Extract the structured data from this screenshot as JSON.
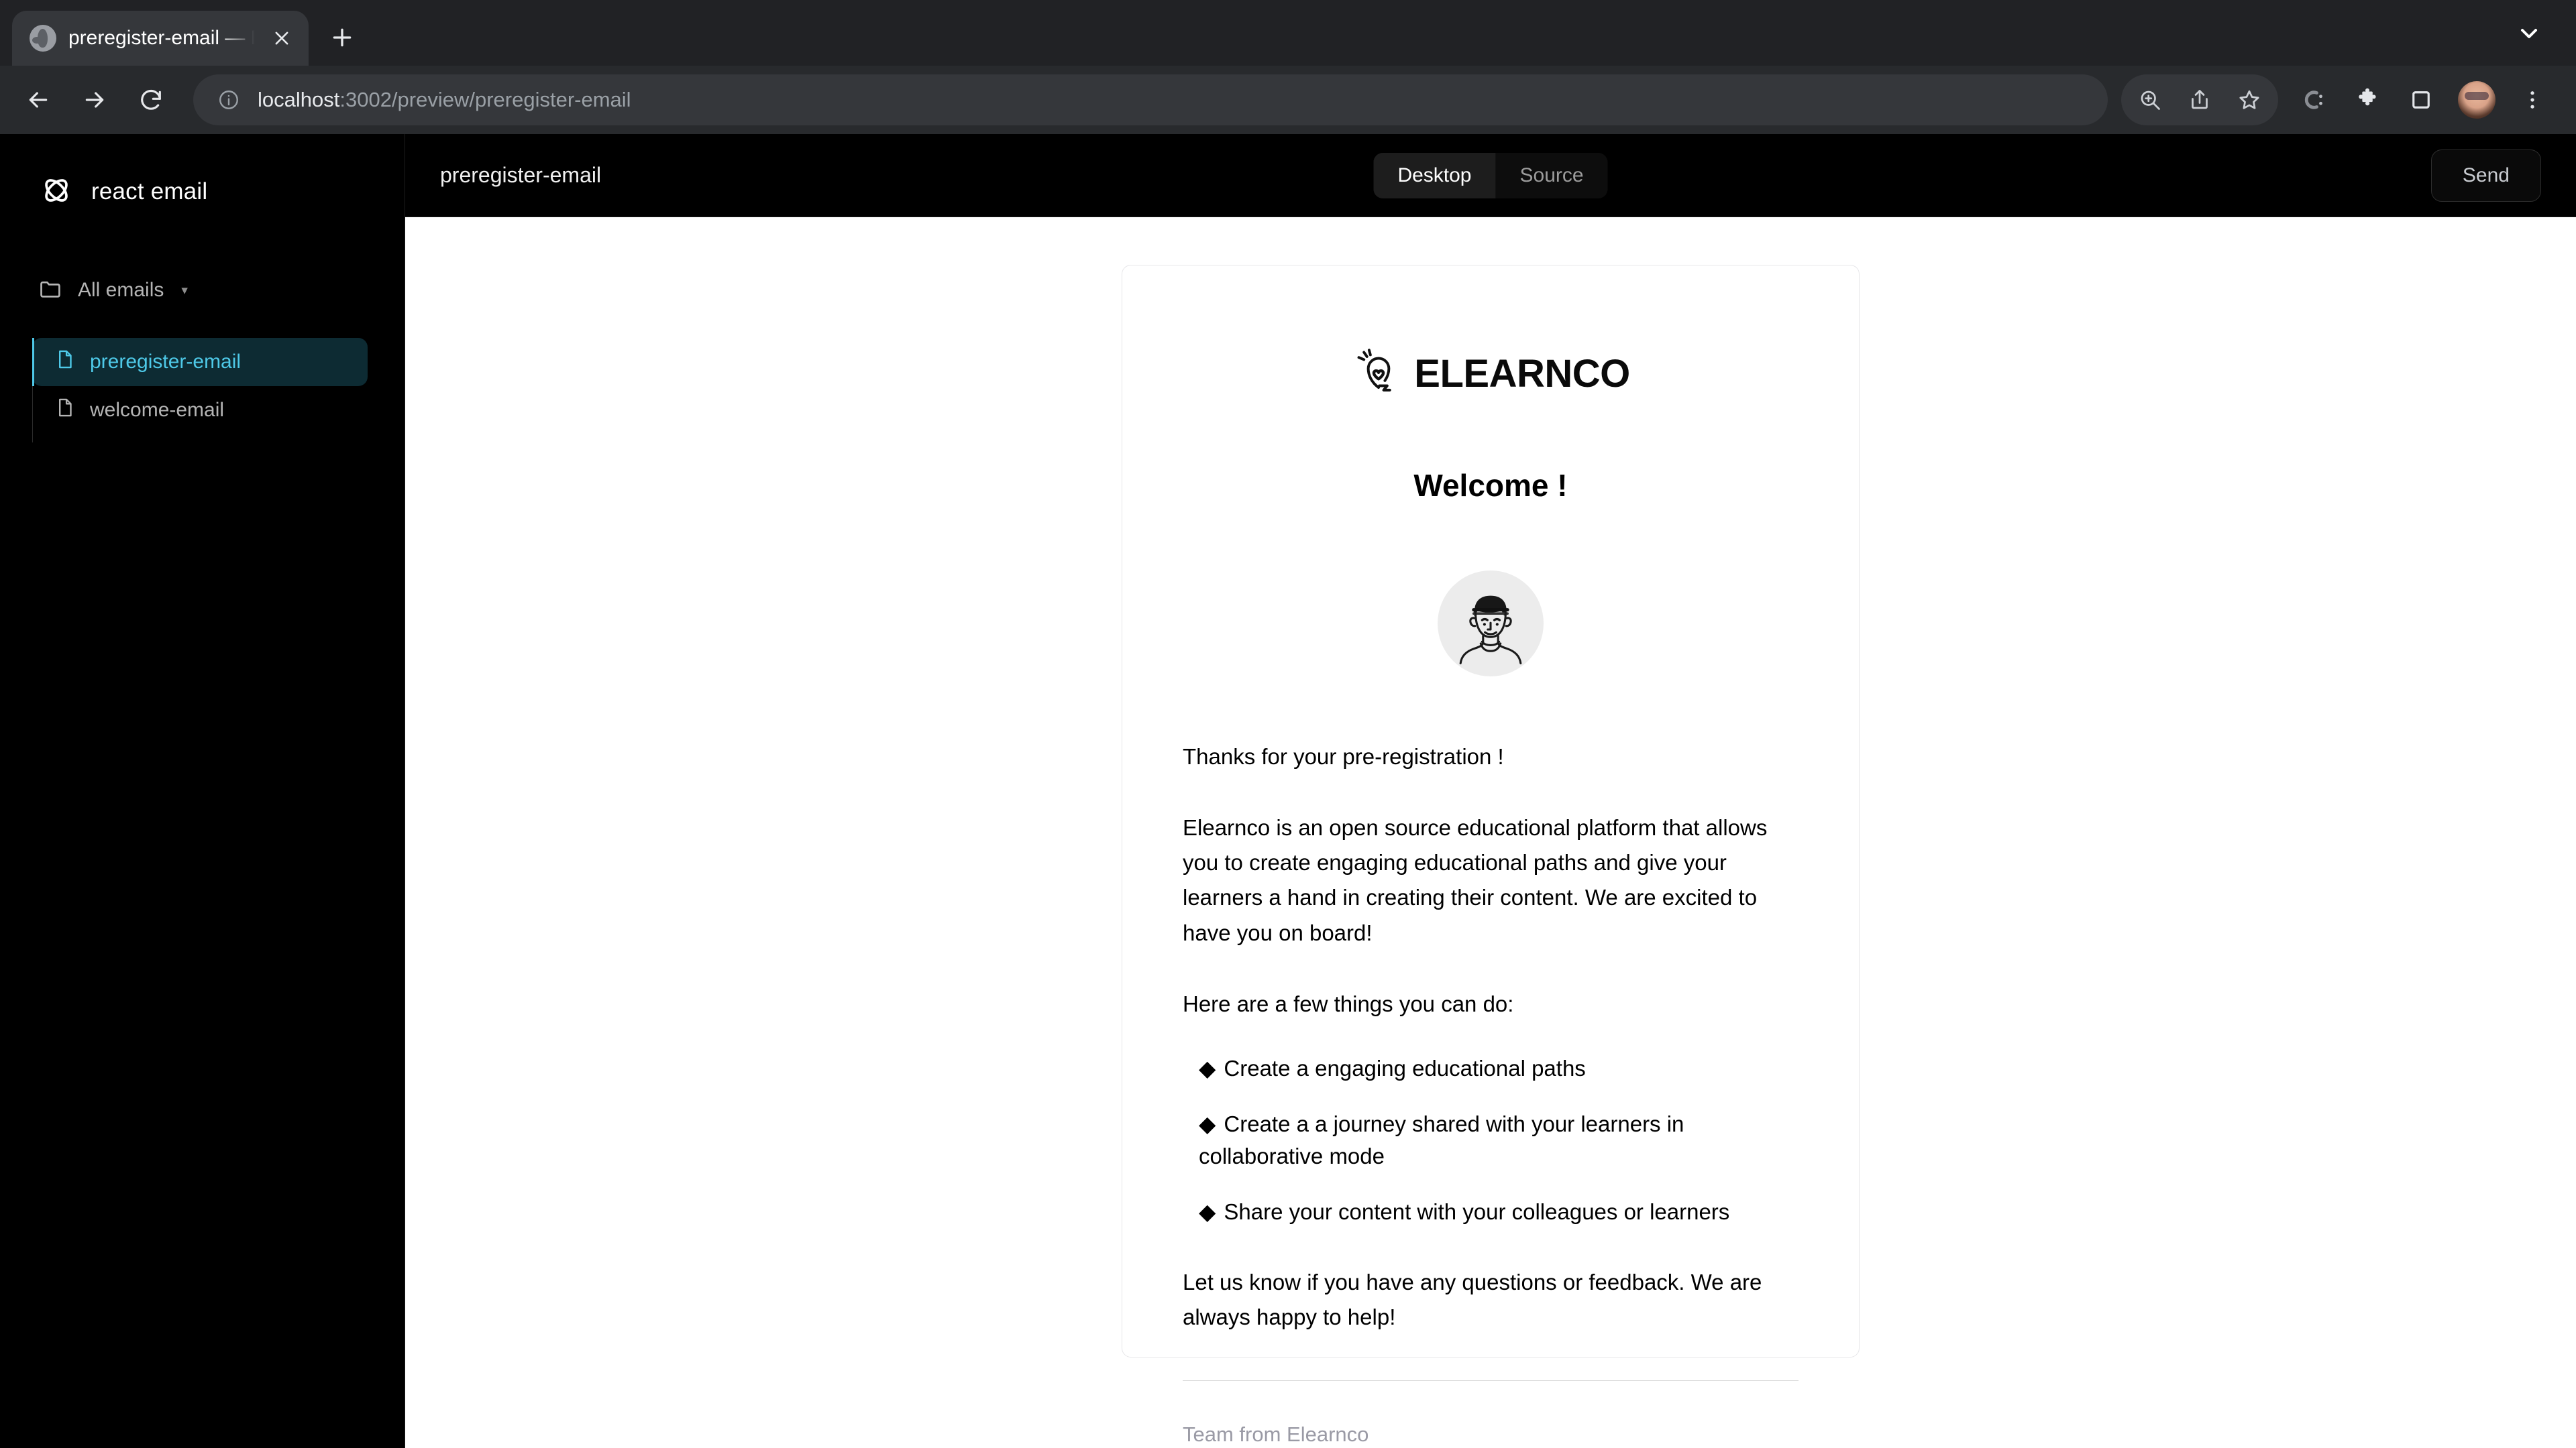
{
  "browser": {
    "tab": {
      "title": "preregister-email — React Email",
      "favicon_icon": "globe-icon",
      "close_icon": "close-icon"
    },
    "new_tab_icon": "plus-icon",
    "tab_list_icon": "chevron-down-icon",
    "toolbar": {
      "back_icon": "back-arrow-icon",
      "forward_icon": "forward-arrow-icon",
      "reload_icon": "reload-icon",
      "site_info_icon": "info-circle-icon",
      "url_host": "localhost",
      "url_rest": ":3002/preview/preregister-email",
      "url_full": "localhost:3002/preview/preregister-email",
      "zoom_icon": "zoom-in-icon",
      "share_icon": "share-icon",
      "bookmark_icon": "star-icon",
      "color_picker_icon": "color-picker-icon",
      "extensions_icon": "puzzle-icon",
      "side_panel_icon": "side-panel-icon",
      "profile_icon": "avatar-icon",
      "menu_icon": "three-dot-menu-icon"
    }
  },
  "app": {
    "brand": {
      "name": "react email",
      "logo_icon": "react-email-atom-icon"
    },
    "sidebar": {
      "folder": {
        "label": "All emails",
        "icon": "folder-icon",
        "caret": "▾"
      },
      "items": [
        {
          "label": "preregister-email",
          "icon": "file-icon",
          "active": true
        },
        {
          "label": "welcome-email",
          "icon": "file-icon",
          "active": false
        }
      ]
    },
    "topbar": {
      "title": "preregister-email",
      "view_modes": [
        {
          "label": "Desktop",
          "active": true
        },
        {
          "label": "Source",
          "active": false
        }
      ],
      "send_label": "Send"
    },
    "colors": {
      "accent": "#4ec9e8",
      "accent_bg": "#0d2b33",
      "chrome_bg": "#282a2d",
      "app_bg": "#000000"
    }
  },
  "email": {
    "logo": {
      "text": "ELEARNCO",
      "icon": "lightbulb-heart-icon"
    },
    "heading": "Welcome !",
    "avatar_icon": "person-illustration-icon",
    "intro": "Thanks for your pre-registration !",
    "body": "Elearnco is an open source educational platform that allows you to create engaging educational paths and give your learners a hand in creating their content. We are excited to have you on board!",
    "list_heading": "Here are a few things you can do:",
    "bullet_glyph": "◆",
    "list": [
      "Create a engaging educational paths",
      "Create a a journey shared with your learners in collaborative mode",
      "Share your content with your colleagues or learners"
    ],
    "closing": "Let us know if you have any questions or feedback. We are always happy to help!",
    "footer": "Team from Elearnco"
  }
}
